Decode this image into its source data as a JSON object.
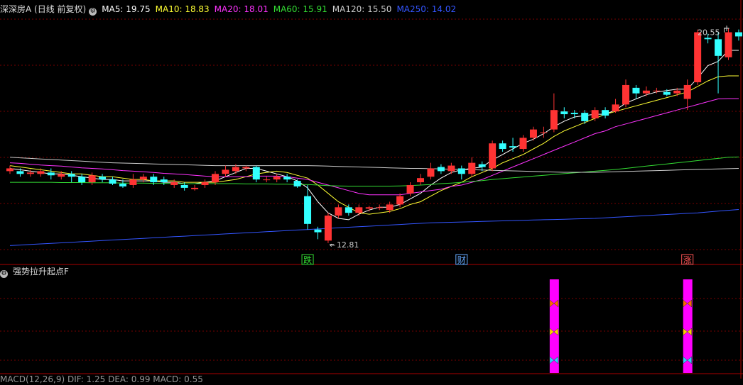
{
  "main_panel": {
    "title": "深深房A (日线 前复权)",
    "indicators": [
      {
        "name": "MA5",
        "value": "19.75",
        "color": "#ffffff"
      },
      {
        "name": "MA10",
        "value": "18.83",
        "color": "#ffff33"
      },
      {
        "name": "MA20",
        "value": "18.01",
        "color": "#ff33ff"
      },
      {
        "name": "MA60",
        "value": "15.91",
        "color": "#33dd33"
      },
      {
        "name": "MA120",
        "value": "15.50",
        "color": "#cccccc"
      },
      {
        "name": "MA250",
        "value": "14.02",
        "color": "#3355ff"
      }
    ],
    "high_label": "20.55",
    "low_label": "12.81",
    "markers": [
      {
        "text": "跌",
        "color": "#33dd33",
        "bar_index": 29
      },
      {
        "text": "财",
        "color": "#66aaff",
        "bar_index": 44
      },
      {
        "text": "涨",
        "color": "#ff5555",
        "bar_index": 66
      }
    ]
  },
  "sub_panel": {
    "title": "强势拉升起点F",
    "signal_bars": [
      53,
      66
    ],
    "signal_color": "#ff00ff",
    "butterfly_colors": [
      "#ff6600",
      "#ffcc00",
      "#33ccff"
    ]
  },
  "macd_panel": {
    "title": "MACD(12,26,9)  DIF: 1.25  DEA: 0.99  MACD: 0.55"
  },
  "colors": {
    "up": "#ff3333",
    "down": "#33ffff",
    "grid": "#770000",
    "border": "#aa0000"
  },
  "chart_data": {
    "type": "candlestick",
    "ylim": [
      12.5,
      21.0
    ],
    "bars": [
      [
        15.4,
        15.5,
        15.6,
        15.3
      ],
      [
        15.4,
        15.3,
        15.5,
        15.2
      ],
      [
        15.3,
        15.35,
        15.45,
        15.2
      ],
      [
        15.3,
        15.4,
        15.5,
        15.2
      ],
      [
        15.35,
        15.25,
        15.5,
        15.1
      ],
      [
        15.2,
        15.3,
        15.4,
        15.1
      ],
      [
        15.3,
        15.2,
        15.4,
        15.0
      ],
      [
        15.2,
        15.0,
        15.3,
        14.9
      ],
      [
        15.0,
        15.25,
        15.35,
        14.9
      ],
      [
        15.2,
        15.1,
        15.3,
        15.0
      ],
      [
        15.1,
        14.95,
        15.2,
        14.9
      ],
      [
        14.95,
        14.85,
        15.1,
        14.8
      ],
      [
        14.9,
        15.1,
        15.3,
        14.8
      ],
      [
        15.1,
        15.2,
        15.3,
        15.0
      ],
      [
        15.2,
        15.0,
        15.3,
        14.9
      ],
      [
        15.1,
        15.0,
        15.2,
        14.9
      ],
      [
        14.9,
        15.0,
        15.1,
        14.8
      ],
      [
        14.9,
        14.8,
        15.0,
        14.7
      ],
      [
        14.75,
        14.8,
        14.9,
        14.7
      ],
      [
        14.9,
        15.0,
        15.1,
        14.8
      ],
      [
        15.0,
        15.3,
        15.4,
        14.9
      ],
      [
        15.3,
        15.45,
        15.6,
        15.2
      ],
      [
        15.4,
        15.55,
        15.65,
        15.3
      ],
      [
        15.5,
        15.55,
        15.6,
        15.4
      ],
      [
        15.55,
        15.1,
        15.6,
        15.0
      ],
      [
        15.1,
        15.1,
        15.2,
        15.0
      ],
      [
        15.1,
        15.2,
        15.3,
        15.0
      ],
      [
        15.2,
        15.1,
        15.3,
        15.0
      ],
      [
        15.05,
        14.85,
        15.1,
        14.8
      ],
      [
        14.5,
        13.5,
        14.9,
        13.3
      ],
      [
        13.3,
        13.2,
        13.4,
        12.95
      ],
      [
        12.9,
        13.8,
        13.9,
        12.81
      ],
      [
        13.8,
        14.1,
        14.2,
        13.7
      ],
      [
        14.1,
        13.9,
        14.2,
        13.8
      ],
      [
        13.9,
        14.1,
        14.2,
        13.8
      ],
      [
        14.05,
        14.1,
        14.15,
        13.95
      ],
      [
        14.1,
        14.1,
        14.2,
        14.0
      ],
      [
        14.0,
        14.2,
        14.3,
        13.9
      ],
      [
        14.2,
        14.5,
        14.6,
        14.1
      ],
      [
        14.6,
        14.9,
        15.0,
        14.5
      ],
      [
        15.0,
        15.15,
        15.3,
        14.9
      ],
      [
        15.2,
        15.5,
        15.7,
        15.1
      ],
      [
        15.55,
        15.4,
        15.65,
        15.3
      ],
      [
        15.4,
        15.6,
        15.7,
        15.3
      ],
      [
        15.5,
        15.3,
        15.6,
        15.1
      ],
      [
        15.3,
        15.7,
        15.9,
        15.2
      ],
      [
        15.65,
        15.55,
        15.75,
        15.4
      ],
      [
        15.5,
        16.4,
        16.5,
        15.4
      ],
      [
        16.4,
        16.2,
        16.5,
        16.1
      ],
      [
        16.3,
        16.25,
        16.6,
        16.1
      ],
      [
        16.2,
        16.6,
        16.7,
        16.1
      ],
      [
        16.6,
        16.9,
        17.0,
        16.5
      ],
      [
        16.8,
        16.8,
        17.0,
        16.6
      ],
      [
        16.9,
        17.6,
        18.2,
        16.8
      ],
      [
        17.55,
        17.45,
        17.7,
        17.3
      ],
      [
        17.5,
        17.45,
        17.6,
        17.3
      ],
      [
        17.5,
        17.2,
        17.6,
        17.1
      ],
      [
        17.3,
        17.6,
        17.7,
        17.2
      ],
      [
        17.6,
        17.4,
        17.7,
        17.3
      ],
      [
        17.55,
        17.8,
        18.0,
        17.5
      ],
      [
        17.8,
        18.5,
        18.7,
        17.7
      ],
      [
        18.4,
        18.2,
        18.5,
        18.0
      ],
      [
        18.2,
        18.3,
        18.45,
        18.1
      ],
      [
        18.3,
        18.3,
        18.4,
        18.2
      ],
      [
        18.25,
        18.15,
        18.35,
        18.1
      ],
      [
        18.2,
        18.3,
        18.4,
        18.1
      ],
      [
        18.0,
        18.5,
        18.7,
        17.6
      ],
      [
        18.6,
        20.4,
        20.5,
        18.5
      ],
      [
        20.2,
        20.15,
        20.35,
        20.0
      ],
      [
        20.15,
        19.55,
        20.4,
        18.2
      ],
      [
        19.5,
        20.4,
        20.55,
        19.4
      ],
      [
        20.4,
        20.25,
        20.5,
        20.1
      ]
    ],
    "ma_lines": [
      {
        "name": "MA5",
        "color": "#ffffff",
        "points": [
          15.5,
          15.45,
          15.4,
          15.35,
          15.3,
          15.3,
          15.25,
          15.2,
          15.15,
          15.1,
          15.1,
          15.05,
          15.05,
          15.05,
          15.05,
          15.0,
          15.0,
          14.95,
          14.95,
          15.0,
          15.05,
          15.2,
          15.35,
          15.5,
          15.5,
          15.4,
          15.3,
          15.2,
          15.05,
          14.8,
          14.3,
          13.9,
          13.7,
          13.65,
          13.85,
          14.0,
          14.1,
          14.1,
          14.2,
          14.4,
          14.6,
          14.9,
          15.15,
          15.35,
          15.45,
          15.5,
          15.55,
          15.8,
          16.0,
          16.2,
          16.4,
          16.55,
          16.75,
          17.0,
          17.2,
          17.35,
          17.4,
          17.45,
          17.45,
          17.6,
          17.85,
          18.0,
          18.15,
          18.25,
          18.3,
          18.35,
          18.35,
          18.75,
          19.2,
          19.35,
          19.75,
          19.75
        ]
      },
      {
        "name": "MA10",
        "color": "#ffff33",
        "points": [
          15.6,
          15.55,
          15.5,
          15.45,
          15.4,
          15.35,
          15.3,
          15.3,
          15.25,
          15.2,
          15.2,
          15.15,
          15.1,
          15.1,
          15.05,
          15.05,
          15.05,
          15.0,
          15.0,
          15.0,
          15.0,
          15.05,
          15.1,
          15.2,
          15.3,
          15.35,
          15.4,
          15.35,
          15.25,
          15.15,
          14.9,
          14.6,
          14.3,
          14.1,
          13.9,
          13.85,
          13.9,
          13.95,
          14.05,
          14.2,
          14.3,
          14.5,
          14.7,
          14.85,
          15.0,
          15.2,
          15.35,
          15.5,
          15.7,
          15.85,
          16.0,
          16.2,
          16.4,
          16.65,
          16.85,
          17.0,
          17.15,
          17.3,
          17.45,
          17.55,
          17.65,
          17.75,
          17.85,
          17.95,
          18.05,
          18.15,
          18.25,
          18.45,
          18.65,
          18.8,
          18.83,
          18.83
        ]
      },
      {
        "name": "MA20",
        "color": "#ff33ff",
        "points": [
          15.7,
          15.68,
          15.65,
          15.62,
          15.6,
          15.58,
          15.55,
          15.52,
          15.5,
          15.48,
          15.45,
          15.42,
          15.4,
          15.38,
          15.35,
          15.32,
          15.3,
          15.28,
          15.25,
          15.22,
          15.2,
          15.2,
          15.2,
          15.2,
          15.22,
          15.22,
          15.22,
          15.2,
          15.15,
          15.1,
          15.0,
          14.9,
          14.8,
          14.7,
          14.6,
          14.55,
          14.55,
          14.55,
          14.55,
          14.6,
          14.65,
          14.7,
          14.75,
          14.85,
          14.9,
          15.0,
          15.1,
          15.25,
          15.4,
          15.55,
          15.7,
          15.85,
          16.0,
          16.15,
          16.3,
          16.45,
          16.6,
          16.75,
          16.85,
          17.0,
          17.1,
          17.2,
          17.3,
          17.4,
          17.5,
          17.6,
          17.7,
          17.8,
          17.9,
          18.0,
          18.01,
          18.01
        ]
      },
      {
        "name": "MA60",
        "color": "#33dd33",
        "points": [
          15.0,
          15.0,
          15.0,
          15.0,
          15.0,
          14.99,
          14.99,
          14.99,
          14.98,
          14.98,
          14.98,
          14.97,
          14.97,
          14.97,
          14.96,
          14.96,
          14.96,
          14.95,
          14.95,
          14.95,
          14.95,
          14.95,
          14.95,
          14.94,
          14.94,
          14.94,
          14.93,
          14.93,
          14.92,
          14.92,
          14.9,
          14.88,
          14.87,
          14.86,
          14.86,
          14.86,
          14.86,
          14.86,
          14.87,
          14.88,
          14.9,
          14.92,
          14.95,
          14.97,
          15.0,
          15.03,
          15.06,
          15.1,
          15.13,
          15.16,
          15.19,
          15.22,
          15.25,
          15.28,
          15.31,
          15.34,
          15.37,
          15.4,
          15.43,
          15.46,
          15.5,
          15.54,
          15.58,
          15.62,
          15.66,
          15.7,
          15.74,
          15.78,
          15.82,
          15.86,
          15.9,
          15.91
        ]
      },
      {
        "name": "MA120",
        "color": "#cccccc",
        "points": [
          15.9,
          15.88,
          15.86,
          15.84,
          15.82,
          15.8,
          15.78,
          15.76,
          15.74,
          15.72,
          15.7,
          15.69,
          15.68,
          15.67,
          15.66,
          15.65,
          15.64,
          15.63,
          15.62,
          15.61,
          15.6,
          15.6,
          15.6,
          15.6,
          15.6,
          15.6,
          15.6,
          15.6,
          15.6,
          15.6,
          15.59,
          15.58,
          15.57,
          15.56,
          15.55,
          15.54,
          15.53,
          15.52,
          15.51,
          15.5,
          15.5,
          15.49,
          15.48,
          15.47,
          15.46,
          15.45,
          15.44,
          15.43,
          15.42,
          15.41,
          15.4,
          15.39,
          15.38,
          15.37,
          15.36,
          15.36,
          15.36,
          15.36,
          15.37,
          15.38,
          15.39,
          15.4,
          15.41,
          15.42,
          15.43,
          15.44,
          15.45,
          15.46,
          15.47,
          15.48,
          15.49,
          15.5
        ]
      },
      {
        "name": "MA250",
        "color": "#3355ff",
        "points": [
          12.72,
          12.74,
          12.76,
          12.78,
          12.8,
          12.82,
          12.84,
          12.86,
          12.88,
          12.9,
          12.92,
          12.94,
          12.96,
          12.98,
          13.0,
          13.02,
          13.04,
          13.06,
          13.08,
          13.1,
          13.12,
          13.14,
          13.16,
          13.18,
          13.2,
          13.22,
          13.24,
          13.26,
          13.28,
          13.3,
          13.32,
          13.34,
          13.36,
          13.38,
          13.4,
          13.42,
          13.44,
          13.46,
          13.48,
          13.5,
          13.52,
          13.54,
          13.55,
          13.56,
          13.57,
          13.58,
          13.59,
          13.6,
          13.61,
          13.62,
          13.63,
          13.64,
          13.65,
          13.66,
          13.67,
          13.68,
          13.69,
          13.7,
          13.72,
          13.74,
          13.76,
          13.78,
          13.8,
          13.82,
          13.84,
          13.86,
          13.88,
          13.9,
          13.93,
          13.96,
          13.99,
          14.02
        ]
      }
    ]
  }
}
